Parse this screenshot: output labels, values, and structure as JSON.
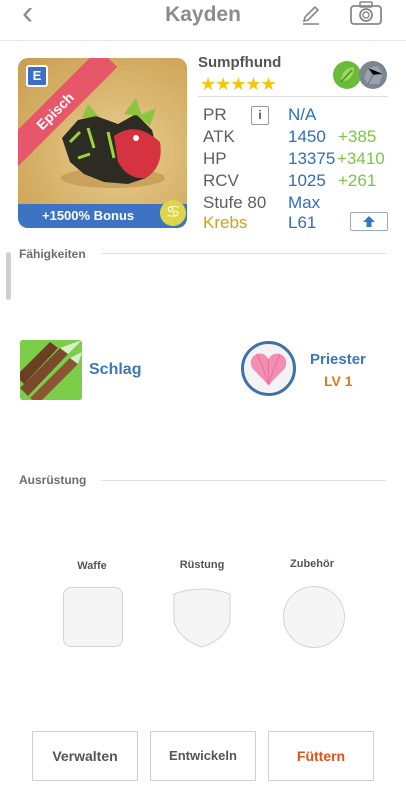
{
  "header": {
    "back_icon": "chevron-left-icon",
    "title": "Kayden",
    "edit_icon": "pencil-icon",
    "camera_icon": "camera-icon"
  },
  "monster": {
    "rarity_letter": "E",
    "rarity": "Episch",
    "bonus": "+1500% Bonus",
    "name": "Sumpfhund",
    "stars": "★★★★★",
    "star_count": 5,
    "elements": [
      "leaf-icon",
      "rock-icon"
    ]
  },
  "stats": {
    "pr": {
      "label": "PR",
      "value": "N/A"
    },
    "atk": {
      "label": "ATK",
      "value": "1450",
      "bonus": "+385"
    },
    "hp": {
      "label": "HP",
      "value": "13375",
      "bonus": "+3410"
    },
    "rcv": {
      "label": "RCV",
      "value": "1025",
      "bonus": "+261"
    },
    "level": {
      "label": "Stufe 80",
      "value": "Max"
    },
    "zodiac": {
      "label": "Krebs",
      "value": "L61"
    }
  },
  "skills": {
    "title": "Fähigkeiten",
    "active": {
      "name": "Schlag"
    },
    "passive": {
      "name": "Priester",
      "level": "LV 1"
    }
  },
  "equipment": {
    "title": "Ausrüstung",
    "weapon": "Waffe",
    "armor": "Rüstung",
    "accessory": "Zubehör"
  },
  "buttons": {
    "manage": "Verwalten",
    "evolve": "Entwickeln",
    "feed": "Füttern"
  },
  "colors": {
    "accent_blue": "#2f6fb8",
    "bonus_green": "#7bc642",
    "feed_orange": "#e0521a",
    "zodiac_gold": "#c9a518"
  }
}
